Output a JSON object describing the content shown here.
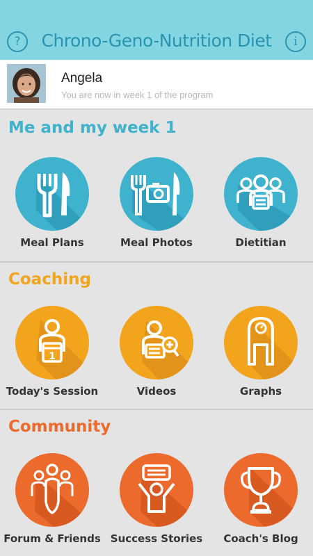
{
  "header": {
    "title": "Chrono-Geno-Nutrition Diet",
    "help_icon": "?",
    "info_icon": "i",
    "background_color": "#83d6e1",
    "accent_color": "#2a94b0"
  },
  "profile": {
    "name": "Angela",
    "week_text": "You are now in week 1 of the program"
  },
  "sections": [
    {
      "title": "Me and my week 1",
      "color": "#3fb2cd",
      "items": [
        {
          "label": "Meal Plans",
          "icon": "fork-knife-icon"
        },
        {
          "label": "Meal Photos",
          "icon": "camera-cutlery-icon"
        },
        {
          "label": "Dietitian",
          "icon": "group-icon"
        }
      ]
    },
    {
      "title": "Coaching",
      "color": "#f2a41d",
      "items": [
        {
          "label": "Today's Session",
          "icon": "trainer-calendar-icon"
        },
        {
          "label": "Videos",
          "icon": "person-zoom-icon"
        },
        {
          "label": "Graphs",
          "icon": "scale-icon"
        }
      ]
    },
    {
      "title": "Community",
      "color": "#ec6a2c",
      "items": [
        {
          "label": "Forum & Friends",
          "icon": "people-icon"
        },
        {
          "label": "Success Stories",
          "icon": "cheering-person-icon"
        },
        {
          "label": "Coach's Blog",
          "icon": "trophy-icon"
        }
      ]
    }
  ]
}
